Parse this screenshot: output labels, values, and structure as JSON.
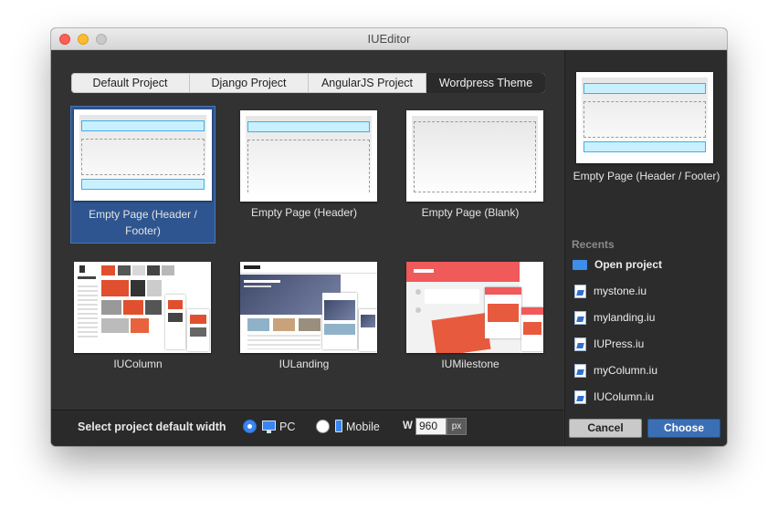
{
  "window": {
    "title": "IUEditor"
  },
  "tabs": [
    {
      "label": "Default Project",
      "active": false
    },
    {
      "label": "Django Project",
      "active": false
    },
    {
      "label": "AngularJS Project",
      "active": false
    },
    {
      "label": "Wordpress Theme",
      "active": true
    }
  ],
  "templates": [
    {
      "label": "Empty Page (Header / Footer)",
      "selected": true
    },
    {
      "label": "Empty Page (Header)",
      "selected": false
    },
    {
      "label": "Empty Page (Blank)",
      "selected": false
    },
    {
      "label": "IUColumn",
      "selected": false
    },
    {
      "label": "IULanding",
      "selected": false
    },
    {
      "label": "IUMilestone",
      "selected": false
    }
  ],
  "preview": {
    "label": "Empty Page (Header / Footer)"
  },
  "recents": {
    "title": "Recents",
    "open_label": "Open project",
    "items": [
      "mystone.iu",
      "mylanding.iu",
      "IUPress.iu",
      "myColumn.iu",
      "IUColumn.iu"
    ]
  },
  "bottom": {
    "label": "Select project default width",
    "pc_label": "PC",
    "mobile_label": "Mobile",
    "selected": "PC",
    "width_label": "W",
    "width_value": "960",
    "width_unit": "px"
  },
  "buttons": {
    "cancel": "Cancel",
    "choose": "Choose"
  },
  "colors": {
    "accent": "#3a86f0",
    "selection": "#2e5590",
    "header_fill": "#c9f0ff",
    "header_border": "#3fb0e6",
    "milestone_red": "#f05a5a"
  }
}
